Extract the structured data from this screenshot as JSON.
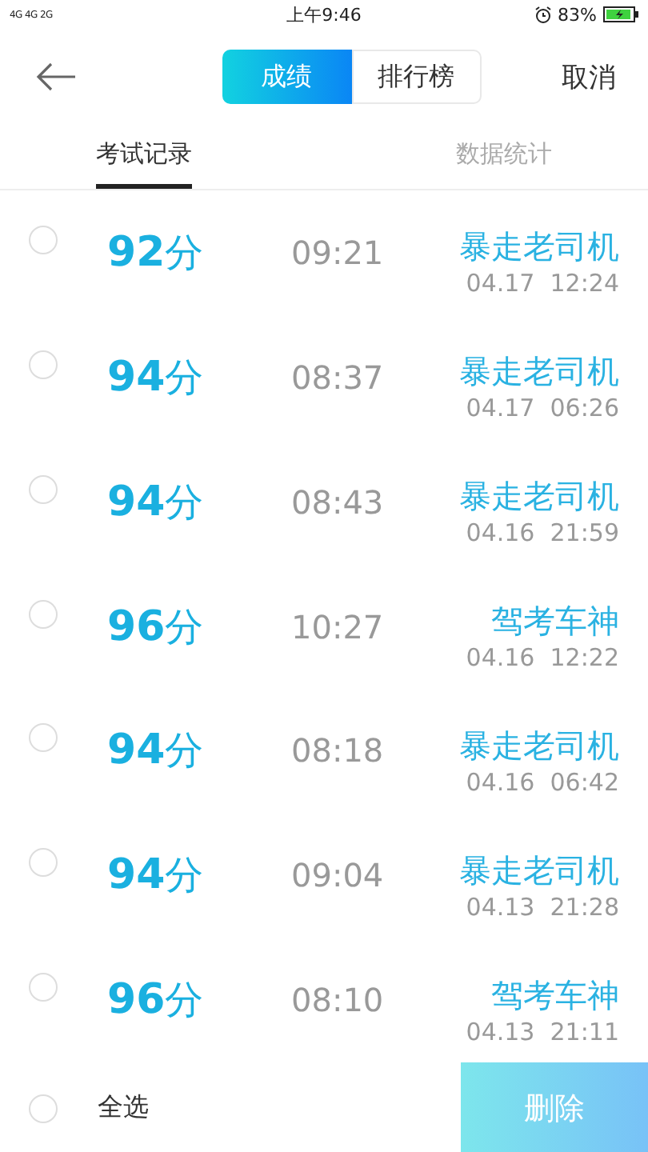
{
  "status_bar": {
    "network": "4G 4G 2G",
    "time": "上午9:46",
    "battery": "83%"
  },
  "header": {
    "segments": [
      {
        "label": "成绩",
        "selected": true
      },
      {
        "label": "排行榜",
        "selected": false
      }
    ],
    "cancel": "取消"
  },
  "tabs": [
    {
      "label": "考试记录",
      "selected": true
    },
    {
      "label": "数据统计",
      "selected": false
    }
  ],
  "records": [
    {
      "score": "**92**分",
      "duration": "09:21",
      "title": "暴走老司机",
      "date": "04.17  12:24",
      "checked": false
    },
    {
      "score": "**94**分",
      "duration": "08:37",
      "title": "暴走老司机",
      "date": "04.17  06:26",
      "checked": false
    },
    {
      "score": "**94**分",
      "duration": "08:43",
      "title": "暴走老司机",
      "date": "04.16  21:59",
      "checked": false
    },
    {
      "score": "**96**分",
      "duration": "10:27",
      "title": "驾考车神",
      "date": "04.16  12:22",
      "checked": false
    },
    {
      "score": "**94**分",
      "duration": "08:18",
      "title": "暴走老司机",
      "date": "04.16  06:42",
      "checked": false
    },
    {
      "score": "**94**分",
      "duration": "09:04",
      "title": "暴走老司机",
      "date": "04.13  21:28",
      "checked": false
    },
    {
      "score": "**96**分",
      "duration": "08:10",
      "title": "驾考车神",
      "date": "04.13  21:11",
      "checked": false
    }
  ],
  "footer": {
    "select_all": "全选",
    "select_all_checked": false,
    "delete": "删除"
  }
}
